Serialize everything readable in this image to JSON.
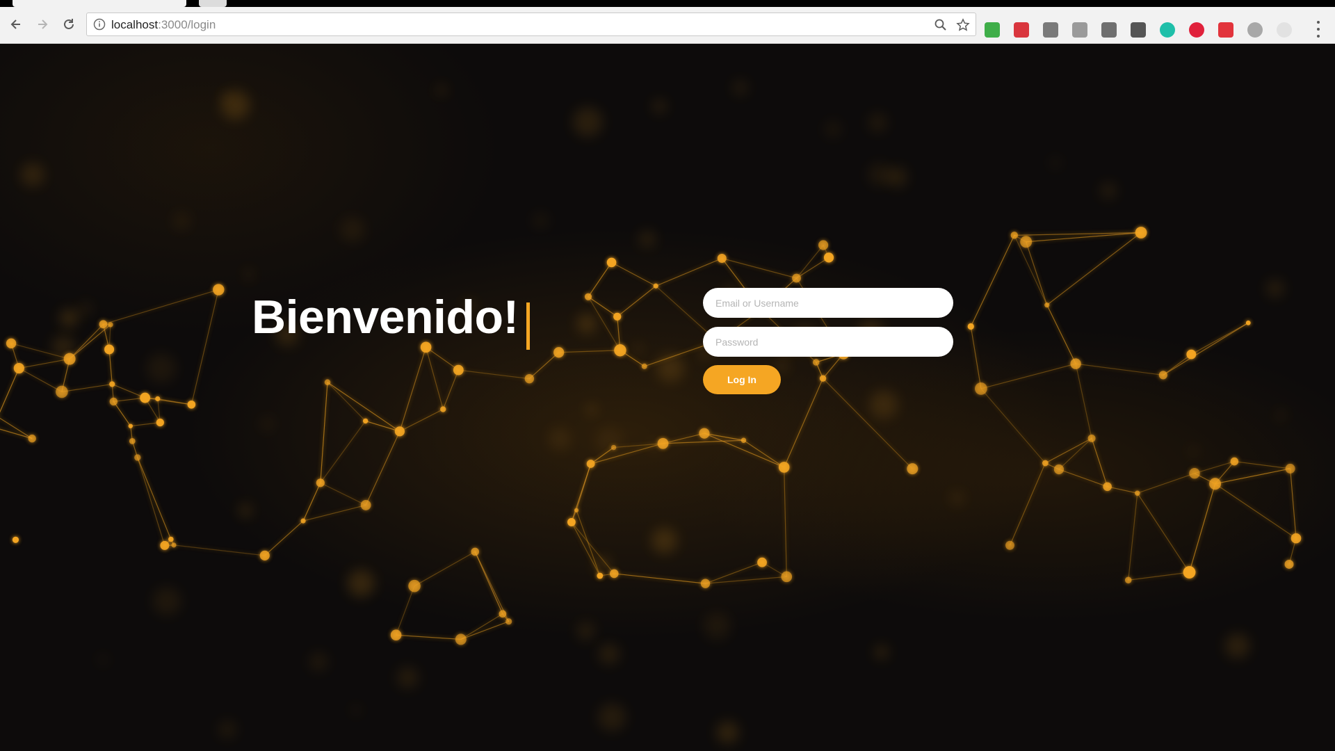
{
  "browser": {
    "url_host": "localhost",
    "url_path": ":3000/login",
    "extensions": [
      {
        "icon": "green-extension-icon",
        "color": "#3fae49"
      },
      {
        "icon": "red-pdf-extension-icon",
        "color": "#d9363e"
      },
      {
        "icon": "recycle-extension-icon",
        "color": "#7a7a7a"
      },
      {
        "icon": "broadcast-extension-icon",
        "color": "#9a9a9a"
      },
      {
        "icon": "grid-extension-icon",
        "color": "#6f6f6f"
      },
      {
        "icon": "eyedropper-extension-icon",
        "color": "#555555"
      },
      {
        "icon": "teal-circle-extension-icon",
        "color": "#1fbfa9"
      },
      {
        "icon": "red-circle-extension-icon",
        "color": "#e0213b"
      },
      {
        "icon": "red-square-extension-icon",
        "color": "#e2343c"
      },
      {
        "icon": "gray-circle-extension-icon",
        "color": "#a8a8a8"
      },
      {
        "icon": "light-circle-extension-icon",
        "color": "#e2e2e2"
      }
    ]
  },
  "page": {
    "welcome_text": "Bienvenido!",
    "email_placeholder": "Email or Username",
    "password_placeholder": "Password",
    "login_label": "Log In"
  },
  "theme": {
    "accent": "#f5a623",
    "background": "#0d0b0b"
  }
}
